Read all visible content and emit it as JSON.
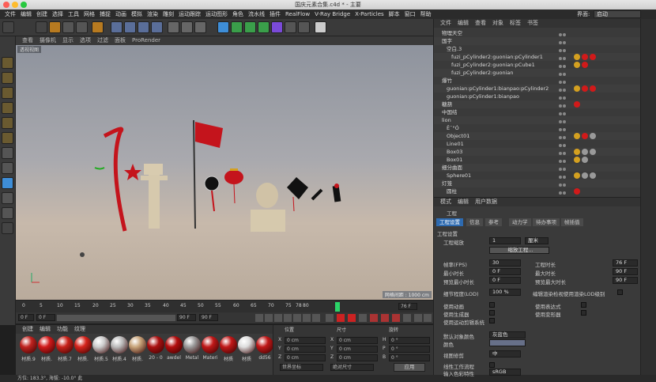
{
  "window": {
    "title": "国庆元素合集.c4d * - 主要"
  },
  "menu": [
    "文件",
    "编辑",
    "创建",
    "选择",
    "工具",
    "网格",
    "捕捉",
    "动画",
    "模拟",
    "渲染",
    "雕刻",
    "运动跟踪",
    "运动图形",
    "角色",
    "流水线",
    "插件",
    "RealFlow",
    "V-Ray Bridge",
    "X-Particles",
    "脚本",
    "窗口",
    "帮助"
  ],
  "layout": {
    "label": "界面:",
    "value": "启动"
  },
  "viewport": {
    "menu": [
      "查看",
      "摄像机",
      "显示",
      "选项",
      "过滤",
      "面板",
      "ProRender"
    ],
    "label": "透视视图",
    "grid_size": "网格间距 : 1000 cm"
  },
  "timeline": {
    "ticks": [
      "0",
      "5",
      "10",
      "15",
      "20",
      "25",
      "30",
      "35",
      "40",
      "45",
      "50",
      "55",
      "60",
      "65",
      "70",
      "75",
      "78",
      "80"
    ],
    "current_frame": "78 F",
    "end_frame": "76 F",
    "start": "0 F",
    "start2": "0 F",
    "end": "90 F",
    "end2": "90 F"
  },
  "materials": {
    "tabs": [
      "创建",
      "编辑",
      "功能",
      "纹理"
    ],
    "items": [
      {
        "label": "材质.9",
        "color": "#c0231f"
      },
      {
        "label": "材质.",
        "color": "#d11a1a"
      },
      {
        "label": "材质.7",
        "color": "#c8221a"
      },
      {
        "label": "材质.",
        "color": "#d6241c"
      },
      {
        "label": "材质.5",
        "color": "#cccccc"
      },
      {
        "label": "材质.4",
        "color": "#bbbbbb"
      },
      {
        "label": "材质.",
        "color": "#c8a47a"
      },
      {
        "label": "20 - 0",
        "color": "#aa1111"
      },
      {
        "label": "awdel",
        "color": "#b30d0d"
      },
      {
        "label": "Metal",
        "color": "#9a9a9a"
      },
      {
        "label": "Materi",
        "color": "#c01818"
      },
      {
        "label": "材质",
        "color": "#c01818"
      },
      {
        "label": "材质",
        "color": "#dddddd"
      },
      {
        "label": "dd56",
        "color": "#c01818"
      }
    ]
  },
  "coords": {
    "header": [
      "位置",
      "尺寸",
      "旋转"
    ],
    "rows": [
      {
        "a": "X",
        "v1": "0 cm",
        "b": "X",
        "v2": "0 cm",
        "c": "H",
        "v3": "0 °"
      },
      {
        "a": "Y",
        "v1": "0 cm",
        "b": "Y",
        "v2": "0 cm",
        "c": "P",
        "v3": "0 °"
      },
      {
        "a": "Z",
        "v1": "0 cm",
        "b": "Z",
        "v2": "0 cm",
        "c": "B",
        "v3": "0 °"
      }
    ],
    "mode1": "世界坐标",
    "mode2": "绝对尺寸",
    "apply": "应用"
  },
  "status": "方位: 183.3°, 海拔: -10.0° 此",
  "objects": {
    "menu": [
      "文件",
      "编辑",
      "查看",
      "对象",
      "标签",
      "书签"
    ],
    "rows": [
      {
        "indent": 0,
        "name": "物理天空",
        "tags": []
      },
      {
        "indent": 0,
        "name": "国字",
        "tags": []
      },
      {
        "indent": 1,
        "name": "空白.3",
        "tags": []
      },
      {
        "indent": 2,
        "name": "fuzi_pCylinder2:guonian:pCylinder1",
        "tags": [
          "#d4a020",
          "#d11a1a",
          "#d11a1a"
        ]
      },
      {
        "indent": 2,
        "name": "fuzi_pCylinder2:guonian:pCube1",
        "tags": [
          "#d4a020",
          "#d11a1a"
        ]
      },
      {
        "indent": 2,
        "name": "fuzi_pCylinder2:guonian",
        "tags": []
      },
      {
        "indent": 0,
        "name": "爆竹",
        "tags": []
      },
      {
        "indent": 1,
        "name": "guonian:pCylinder1:bianpao:pCylinder2",
        "tags": [
          "#d4a020",
          "#d11a1a",
          "#d11a1a"
        ]
      },
      {
        "indent": 1,
        "name": "guonian:pCylinder1:bianpao",
        "tags": []
      },
      {
        "indent": 0,
        "name": "糖葫",
        "tags": [
          "#d11a1a"
        ]
      },
      {
        "indent": 0,
        "name": "中国结",
        "tags": []
      },
      {
        "indent": 0,
        "name": "lion",
        "tags": []
      },
      {
        "indent": 1,
        "name": "Ê¯°Ó",
        "tags": []
      },
      {
        "indent": 1,
        "name": "Object01",
        "tags": [
          "#d4a020",
          "#d11a1a",
          "#999999"
        ]
      },
      {
        "indent": 1,
        "name": "Line01",
        "tags": []
      },
      {
        "indent": 1,
        "name": "Box03",
        "tags": [
          "#d4a020",
          "#999999",
          "#999999"
        ]
      },
      {
        "indent": 1,
        "name": "Box01",
        "tags": [
          "#d4a020",
          "#999999"
        ]
      },
      {
        "indent": 0,
        "name": "细分曲面",
        "tags": []
      },
      {
        "indent": 1,
        "name": "Sphere01",
        "tags": [
          "#d4a020",
          "#999999",
          "#999999"
        ]
      },
      {
        "indent": 0,
        "name": "灯笼",
        "tags": []
      },
      {
        "indent": 1,
        "name": "圆柱",
        "tags": [
          "#d11a1a"
        ]
      }
    ]
  },
  "attributes": {
    "menu": [
      "模式",
      "编辑",
      "用户数据"
    ],
    "title": "工程",
    "tabs": [
      "工程设置",
      "信息",
      "参考",
      "动力学",
      "待办事项",
      "帧插值"
    ],
    "section": "工程设置",
    "scale_label": "工程缩放",
    "scale_value": "1",
    "scale_unit": "厘米",
    "scale_button": "缩放工程...",
    "fields": [
      {
        "label": "帧率(FPS)",
        "value": "30",
        "label2": "工程时长",
        "value2": "76 F"
      },
      {
        "label": "最小时长",
        "value": "0 F",
        "label2": "最大时长",
        "value2": "90 F"
      },
      {
        "label": "预览最小时长",
        "value": "0 F",
        "label2": "预览最大时长",
        "value2": "90 F"
      }
    ],
    "lod_label": "细节程度(LOD)",
    "lod_value": "100 %",
    "lod_check": "编辑渲染检视使用渲染LOD级别",
    "checks": [
      {
        "label": "使用动画",
        "label2": "使用表达式"
      },
      {
        "label": "使用生成器",
        "label2": "使用变形器"
      },
      {
        "label": "使用运动剪辑系统",
        "label2": ""
      }
    ],
    "default_color_label": "默认对象颜色",
    "default_color_value": "灰蓝色",
    "color_label": "颜色",
    "view_clip_label": "视图修剪",
    "view_clip_value": "中",
    "linear_label": "线性工作流程",
    "input_color_label": "输入色彩特性",
    "input_color_value": "sRGB"
  }
}
